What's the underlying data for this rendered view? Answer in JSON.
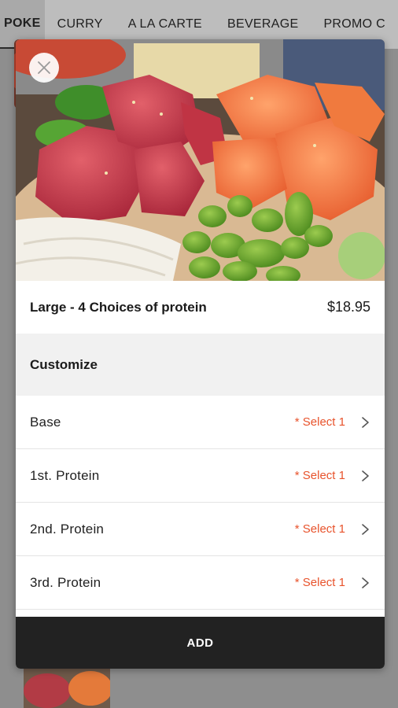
{
  "tabs": [
    {
      "label": "POKE",
      "active": true
    },
    {
      "label": "CURRY",
      "active": false
    },
    {
      "label": "A LA CARTE",
      "active": false
    },
    {
      "label": "BEVERAGE",
      "active": false
    },
    {
      "label": "PROMO C",
      "active": false
    }
  ],
  "modal": {
    "close_icon": "close-icon",
    "item_title": "Large - 4 Choices of protein",
    "item_price": "$18.95",
    "customize_label": "Customize",
    "options": [
      {
        "label": "Base",
        "requirement": "* Select 1"
      },
      {
        "label": "1st. Protein",
        "requirement": "* Select 1"
      },
      {
        "label": "2nd. Protein",
        "requirement": "* Select 1"
      },
      {
        "label": "3rd. Protein",
        "requirement": "* Select 1"
      }
    ],
    "add_label": "ADD"
  },
  "colors": {
    "accent_required": "#e8532c",
    "add_bar": "#222222",
    "customize_bg": "#f1f1f1"
  }
}
